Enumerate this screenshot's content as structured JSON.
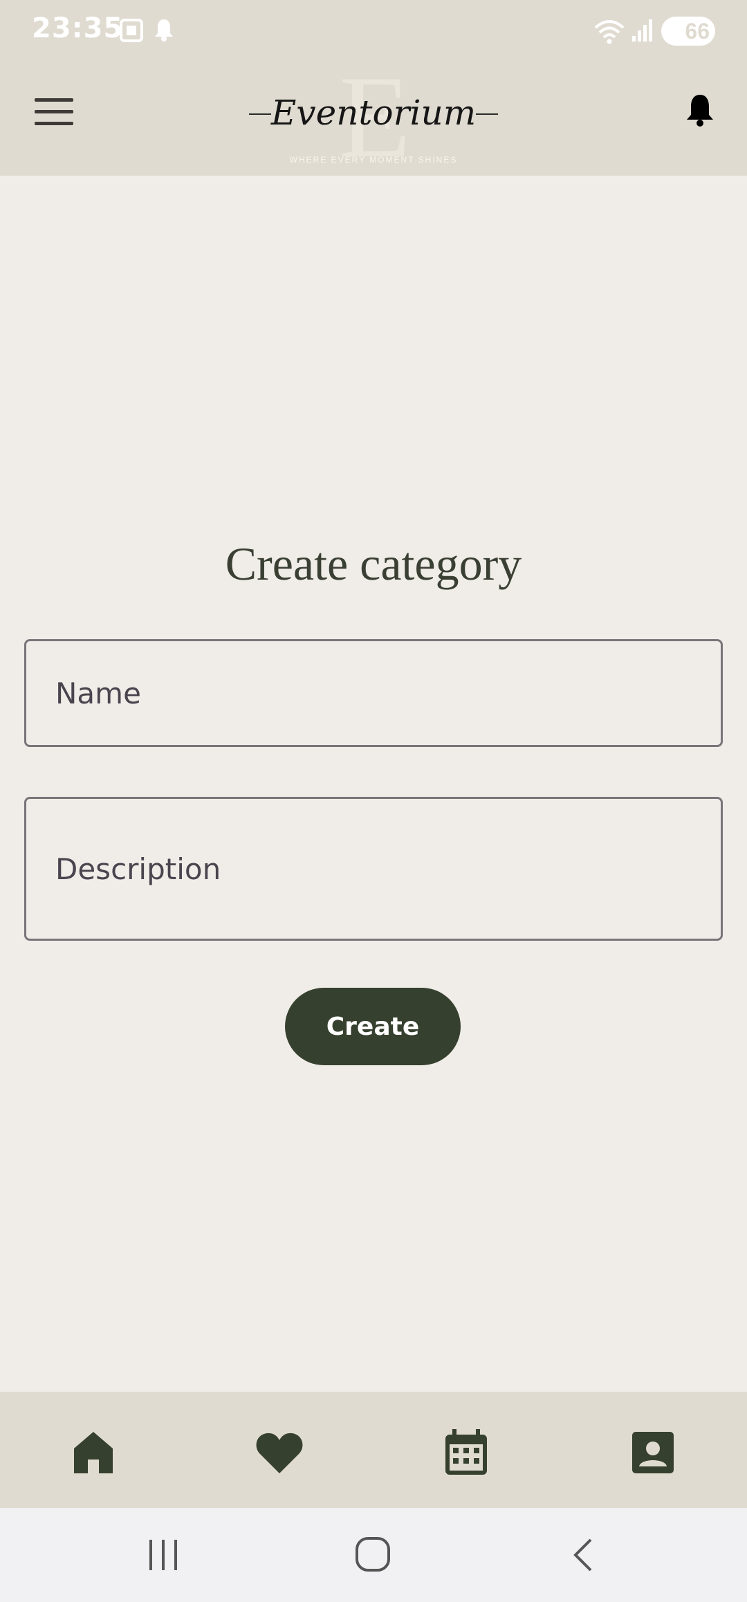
{
  "status_bar": {
    "time": "23:35",
    "battery_level": "66",
    "icons": [
      "screenshot-icon",
      "notification-bell-icon",
      "wifi-icon",
      "signal-icon",
      "battery-charging-icon"
    ]
  },
  "header": {
    "logo_title": "Eventorium",
    "logo_letter": "E",
    "logo_tagline": "WHERE EVERY MOMENT SHINES",
    "menu_icon": "hamburger-menu-icon",
    "notification_icon": "bell-icon"
  },
  "form": {
    "title": "Create category",
    "name_placeholder": "Name",
    "name_value": "",
    "description_placeholder": "Description",
    "description_value": "",
    "submit_label": "Create"
  },
  "bottom_nav": {
    "items": [
      {
        "icon": "home-icon"
      },
      {
        "icon": "heart-icon"
      },
      {
        "icon": "calendar-icon"
      },
      {
        "icon": "contact-profile-icon"
      }
    ]
  },
  "system_nav": {
    "items": [
      {
        "icon": "recent-apps-icon"
      },
      {
        "icon": "home-circle-icon"
      },
      {
        "icon": "back-icon"
      }
    ]
  },
  "colors": {
    "bar_background": "#e0dbd0",
    "page_background": "#f0ede8",
    "accent_green": "#36402e",
    "title_color": "#3a3f33"
  }
}
